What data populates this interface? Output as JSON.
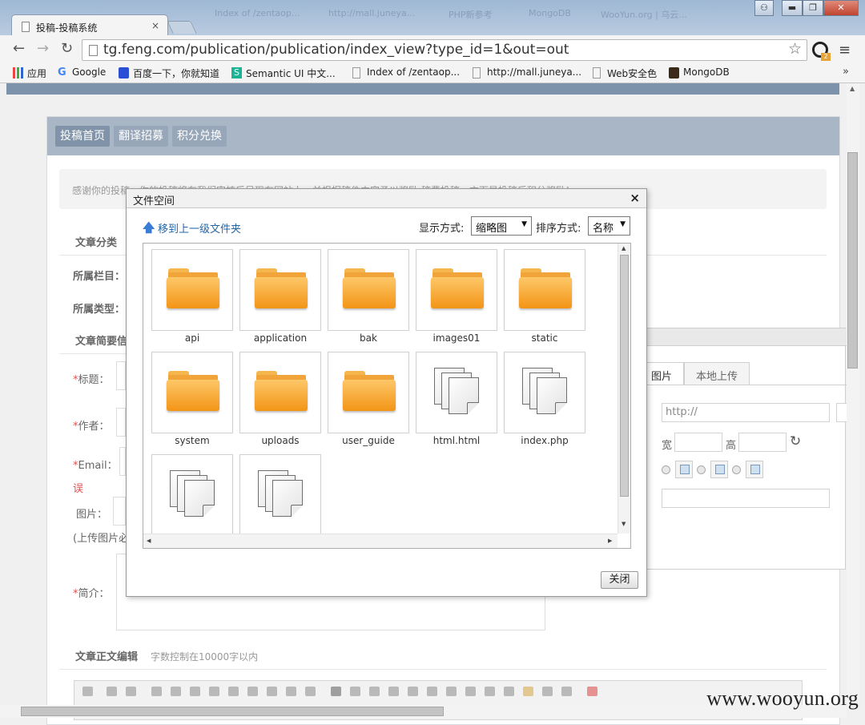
{
  "browser": {
    "tab_title": "投稿-投稿系统",
    "tab_close": "×",
    "faint_tabs": [
      "Index of /zentaop...",
      "http://mall.juneya...",
      "PHP新参考",
      "MongoDB",
      "WooYun.org | 乌云...",
      ""
    ],
    "url": "tg.feng.com/publication/publication/index_view?type_id=1&out=out",
    "star": "☆",
    "ext_badge": "2",
    "menu": "≡",
    "window_controls": {
      "user": "⚇",
      "min": "▬",
      "max": "❐",
      "close": "✕"
    },
    "nav": {
      "back": "←",
      "forward": "→",
      "reload": "↻"
    },
    "bookmarks": [
      "应用",
      "Google",
      "百度一下，你就知道",
      "Semantic UI 中文...",
      "Index of /zentaop...",
      "http://mall.juneya...",
      "Web安全色",
      "MongoDB"
    ],
    "bookmarks_more": "»"
  },
  "page": {
    "tabs": [
      "投稿首页",
      "翻译招募",
      "积分兑换"
    ],
    "notice": "感谢你的投稿，你的投稿将在我们审核后呈现在网站上，并根据稿件内容予以奖励,稿费投稿一方面是投稿后积分奖励！",
    "labels": {
      "category_section": "文章分类",
      "column": "所属栏目：",
      "type": "所属类型：",
      "summary_section": "文章简要信",
      "title": "标题：",
      "author": "作者：",
      "email": "Email：",
      "error": "误",
      "image": "图片：",
      "image_hint": "(上传图片必",
      "intro": "简介：",
      "body_section": "文章正文编辑",
      "body_hint": "字数控制在10000字以内",
      "required_mark": "*"
    }
  },
  "image_dialog": {
    "tabs": [
      "图片",
      "本地上传"
    ],
    "url_placeholder": "http://",
    "width_label": "宽",
    "height_label": "高",
    "refresh": "↻"
  },
  "file_dialog": {
    "title": "文件空间",
    "close": "×",
    "up_link": "移到上一级文件夹",
    "up_arrow": "🡅",
    "display_label": "显示方式:",
    "display_value": "缩略图",
    "sort_label": "排序方式:",
    "sort_value": "名称",
    "dropdown_arrow": "▼",
    "files": [
      {
        "name": "api",
        "kind": "folder-icon"
      },
      {
        "name": "application",
        "kind": "folder-icon"
      },
      {
        "name": "bak",
        "kind": "folder-icon"
      },
      {
        "name": "images01",
        "kind": "folder-icon"
      },
      {
        "name": "static",
        "kind": "folder-icon"
      },
      {
        "name": "system",
        "kind": "folder-icon"
      },
      {
        "name": "uploads",
        "kind": "folder-icon"
      },
      {
        "name": "user_guide",
        "kind": "folder-icon"
      },
      {
        "name": "html.html",
        "kind": "file-icon"
      },
      {
        "name": "index.php",
        "kind": "file-icon"
      },
      {
        "name": "",
        "kind": "file-icon"
      },
      {
        "name": "",
        "kind": "file-icon"
      }
    ],
    "scroll_up": "▲",
    "scroll_down": "▼",
    "scroll_left": "◀",
    "scroll_right": "▶",
    "close_button": "关闭"
  },
  "watermark": "www.wooyun.org",
  "colors": {
    "folder": "#f39516",
    "link": "#2266aa",
    "required": "#e05050",
    "panel_header": "#a9b6c5"
  }
}
